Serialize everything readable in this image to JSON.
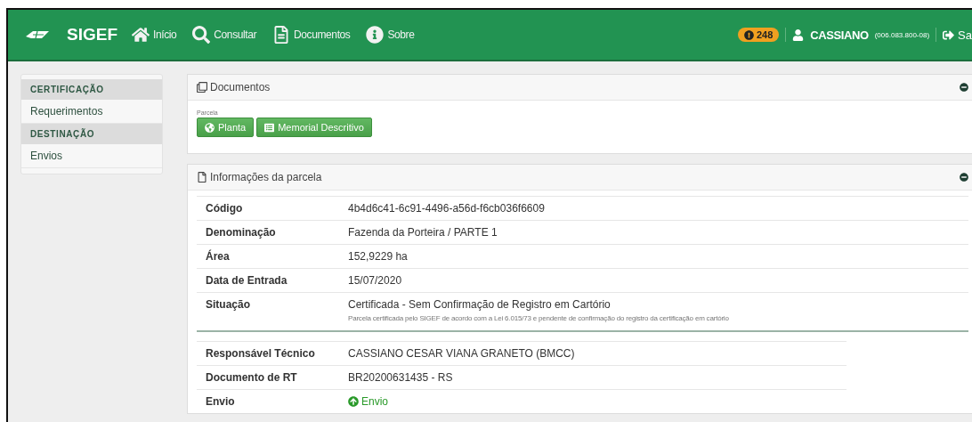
{
  "navbar": {
    "brand": "SIGEF",
    "links": [
      {
        "label": "Início"
      },
      {
        "label": "Consultar"
      },
      {
        "label": "Documentos"
      },
      {
        "label": "Sobre"
      }
    ],
    "badge": "248",
    "user": "CASSIANO",
    "user_id": "(006.083.800-08)",
    "logout": "Sa"
  },
  "sidebar": {
    "sections": [
      {
        "heading": "CERTIFICAÇÃO",
        "items": [
          "Requerimentos"
        ]
      },
      {
        "heading": "DESTINAÇÃO",
        "items": [
          "Envios"
        ]
      }
    ]
  },
  "documents_panel": {
    "title": "Documentos",
    "group_label": "Parcela",
    "buttons": [
      {
        "label": "Planta"
      },
      {
        "label": "Memorial Descritivo"
      }
    ]
  },
  "info_panel": {
    "title": "Informações da parcela",
    "rows": [
      {
        "label": "Código",
        "value": "4b4d6c41-6c91-4496-a56d-f6cb036f6609"
      },
      {
        "label": "Denominação",
        "value": "Fazenda da Porteira / PARTE 1"
      },
      {
        "label": "Área",
        "value": "152,9229 ha"
      },
      {
        "label": "Data de Entrada",
        "value": "15/07/2020"
      },
      {
        "label": "Situação",
        "value": "Certificada - Sem Confirmação de Registro em Cartório",
        "note": "Parcela certificada pelo SIGEF de acordo com a Lei 6.015/73 e pendente de confirmação do registro da certificação em cartório"
      }
    ],
    "rows_2": [
      {
        "label": "Responsável Técnico",
        "value": "CASSIANO CESAR VIANA GRANETO (BMCC)",
        "kind": "text"
      },
      {
        "label": "Documento de RT",
        "value": "BR20200631435 - RS",
        "kind": "text"
      },
      {
        "label": "Envio",
        "value": "Envio",
        "kind": "link"
      }
    ]
  }
}
